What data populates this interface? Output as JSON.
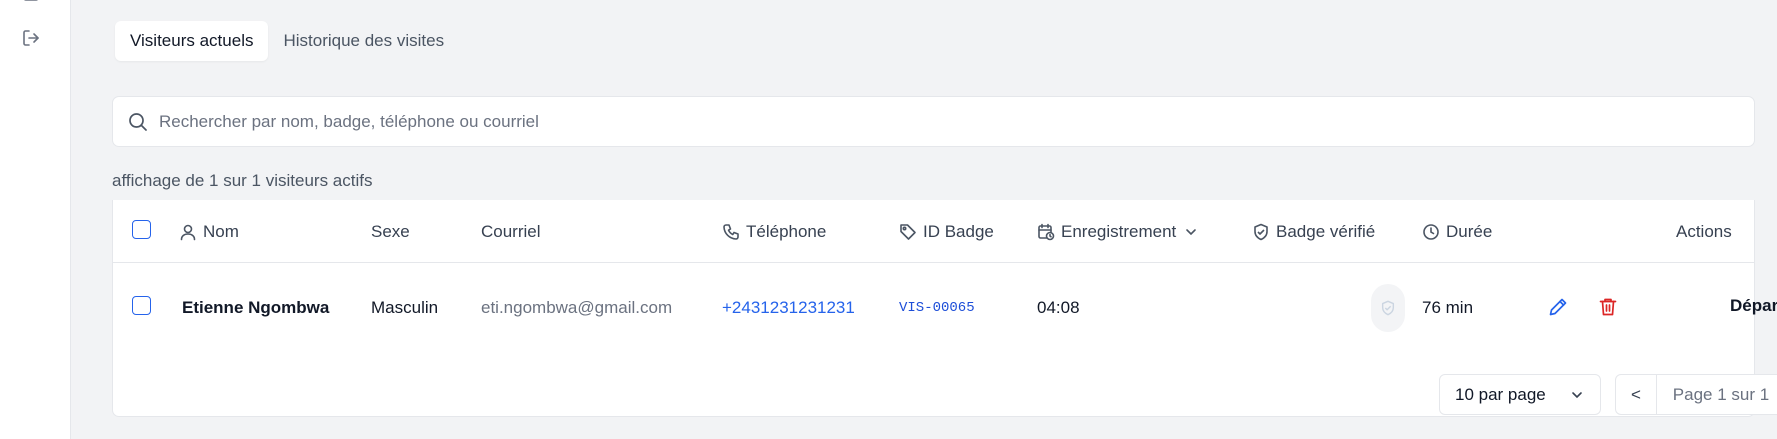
{
  "tabs": [
    {
      "label": "Visiteurs actuels",
      "active": true
    },
    {
      "label": "Historique des visites",
      "active": false
    }
  ],
  "search": {
    "placeholder": "Rechercher par nom, badge, téléphone ou courriel",
    "value": ""
  },
  "summary": "affichage de 1 sur 1 visiteurs actifs",
  "table": {
    "columns": {
      "name": "Nom",
      "sex": "Sexe",
      "email": "Courriel",
      "phone": "Téléphone",
      "badge_id": "ID Badge",
      "checkin": "Enregistrement",
      "badge_verified": "Badge vérifié",
      "duration": "Durée",
      "actions": "Actions"
    },
    "rows": [
      {
        "name": "Etienne Ngombwa",
        "sex": "Masculin",
        "email": "eti.ngombwa@gmail.com",
        "phone": "+2431231231231",
        "badge_id": "VIS-00065",
        "checkin": "04:08",
        "badge_verified": false,
        "duration": "76 min",
        "depart_label": "Départ"
      }
    ]
  },
  "pagination": {
    "per_page": "10 par page",
    "prev": "<",
    "page_info": "Page 1 sur 1",
    "next": ">"
  },
  "colors": {
    "accent": "#2563eb",
    "danger": "#dc2626",
    "background": "#f2f3f5"
  },
  "icons": [
    "logout-icon",
    "search-icon",
    "user-icon",
    "phone-icon",
    "tag-icon",
    "calendar-clock-icon",
    "chevron-down-icon",
    "shield-check-icon",
    "clock-icon",
    "pencil-icon",
    "trash-icon"
  ]
}
